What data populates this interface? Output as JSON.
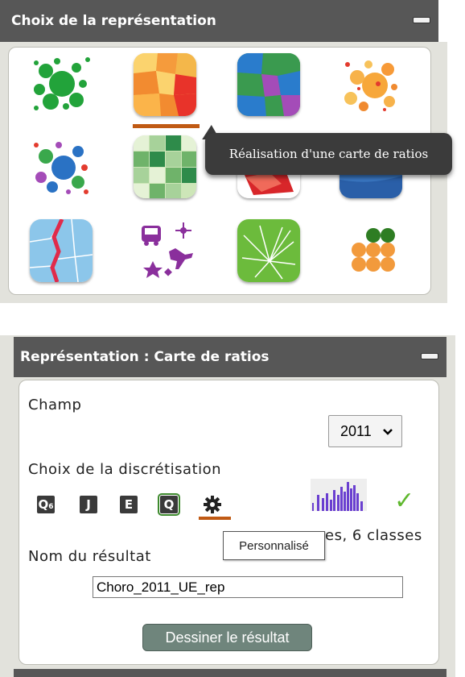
{
  "panel1": {
    "title": "Choix de la représentation",
    "tooltip": "Réalisation d'une carte de ratios",
    "selected_index": 1,
    "tiles": [
      {
        "icon": "proportional-circles-icon"
      },
      {
        "icon": "ratio-map-icon"
      },
      {
        "icon": "typology-map-icon"
      },
      {
        "icon": "circles-on-choropleth-icon"
      },
      {
        "icon": "colored-circles-icon"
      },
      {
        "icon": "grid-map-icon"
      },
      {
        "icon": "discontinuity-map-icon"
      },
      {
        "icon": "smooth-map-icon"
      },
      {
        "icon": "borders-map-icon"
      },
      {
        "icon": "symbols-map-icon"
      },
      {
        "icon": "flows-map-icon"
      },
      {
        "icon": "waffle-chart-icon"
      }
    ]
  },
  "panel2": {
    "title": "Représentation : Carte de ratios",
    "field_label": "Champ",
    "field_value": "2011",
    "discretization_label": "Choix de la discrétisation",
    "methods": {
      "q6": "Q",
      "q6_sub": "6",
      "j": "J",
      "e": "E",
      "q": "Q"
    },
    "selected_method": "Q",
    "tooltip": "Personnalisé",
    "info_text": "es, 6 classes",
    "result_label": "Nom du résultat",
    "result_value": "Choro_2011_UE_rep",
    "draw_button": "Dessiner le résultat"
  },
  "colors": {
    "header_bg": "#575757",
    "accent_underline": "#c05a14",
    "check": "#5fb82e",
    "draw_button_bg": "#6f857c",
    "histogram": "#6a3fd0"
  }
}
